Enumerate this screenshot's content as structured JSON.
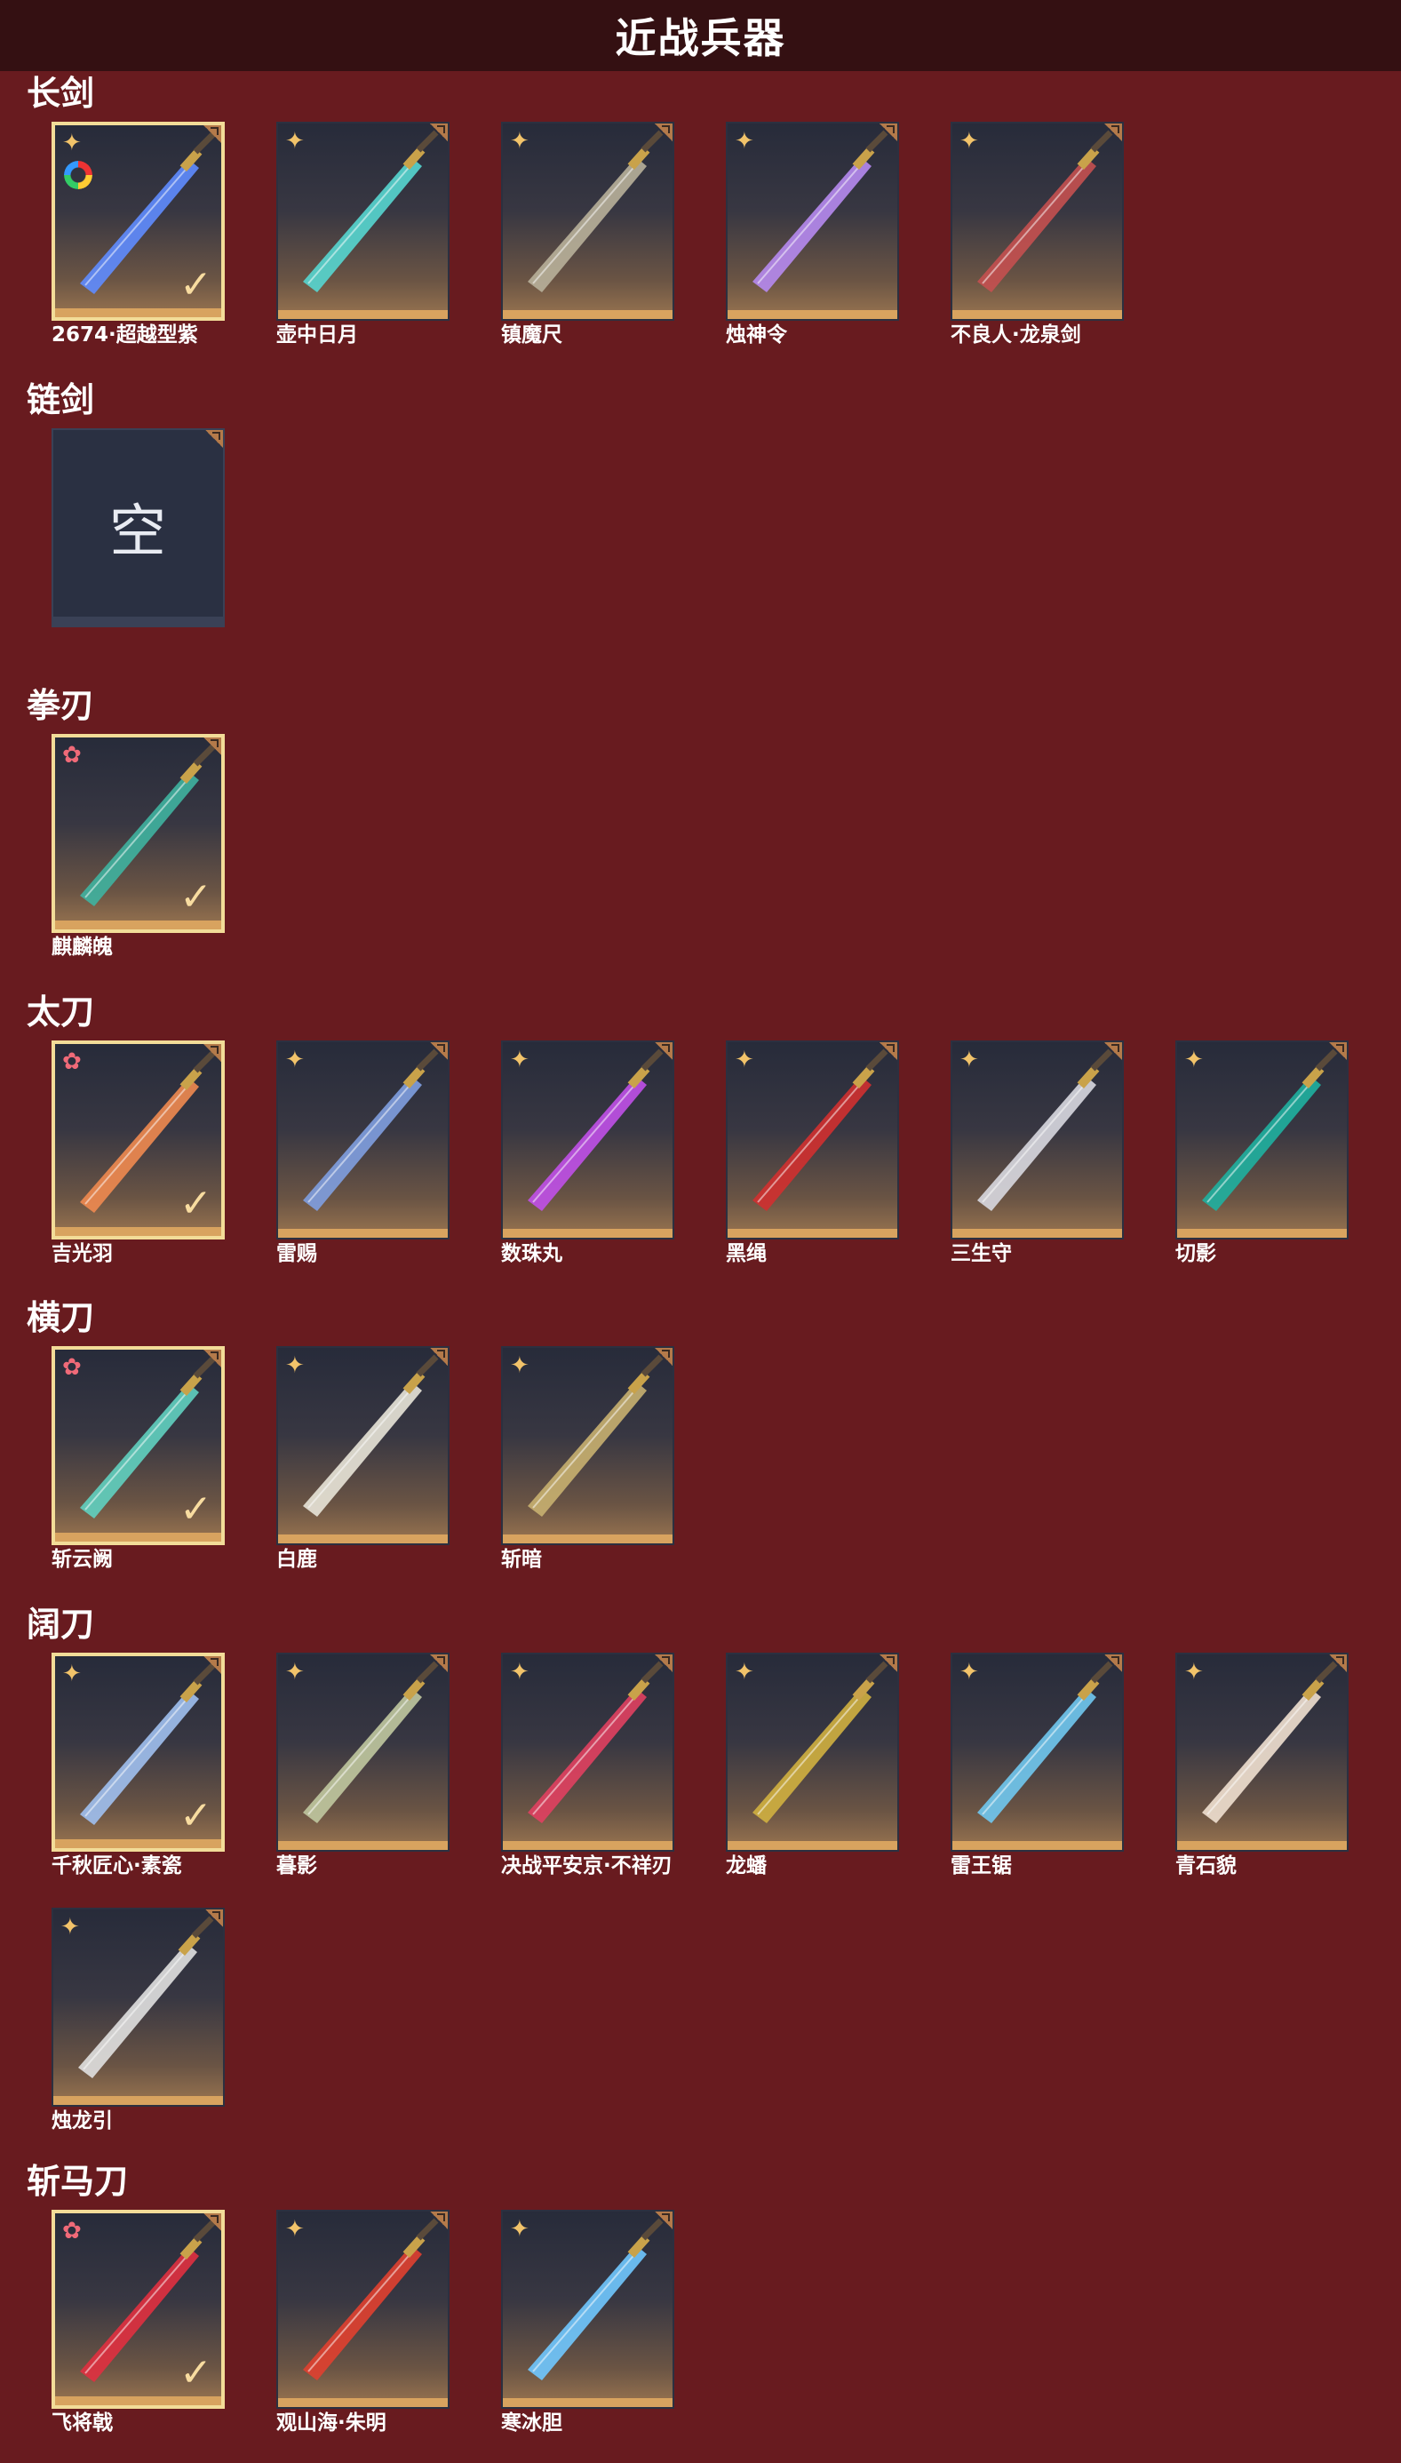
{
  "header": {
    "title": "近战兵器"
  },
  "sections": [
    {
      "title": "长剑",
      "items": [
        {
          "name": "2674·超越型紫",
          "rarity": "gold",
          "selected": true,
          "blade": "#5f8cff",
          "ring": true
        },
        {
          "name": "壶中日月",
          "rarity": "gold",
          "selected": false,
          "blade": "#57d6d0"
        },
        {
          "name": "镇魔尺",
          "rarity": "gold",
          "selected": false,
          "blade": "#b8b09a"
        },
        {
          "name": "烛神令",
          "rarity": "gold",
          "selected": false,
          "blade": "#b68af0"
        },
        {
          "name": "不良人·龙泉剑",
          "rarity": "gold",
          "selected": false,
          "blade": "#c45050"
        }
      ]
    },
    {
      "title": "链剑",
      "items": [
        {
          "name": "",
          "empty": true,
          "empty_text": "空"
        }
      ]
    },
    {
      "title": "拳刃",
      "items": [
        {
          "name": "麒麟魄",
          "rarity": "red",
          "selected": true,
          "blade": "#3fb3a0"
        }
      ]
    },
    {
      "title": "太刀",
      "items": [
        {
          "name": "吉光羽",
          "rarity": "red",
          "selected": true,
          "blade": "#f08a50"
        },
        {
          "name": "雷赐",
          "rarity": "gold",
          "selected": false,
          "blade": "#7f9ee0"
        },
        {
          "name": "数珠丸",
          "rarity": "gold",
          "selected": false,
          "blade": "#c050e8"
        },
        {
          "name": "黑绳",
          "rarity": "gold",
          "selected": false,
          "blade": "#d03030"
        },
        {
          "name": "三生守",
          "rarity": "gold",
          "selected": false,
          "blade": "#d8d8e0"
        },
        {
          "name": "切影",
          "rarity": "gold",
          "selected": false,
          "blade": "#1fb0a0"
        }
      ]
    },
    {
      "title": "横刀",
      "items": [
        {
          "name": "斩云阙",
          "rarity": "red",
          "selected": true,
          "blade": "#60d0c0"
        },
        {
          "name": "白鹿",
          "rarity": "gold",
          "selected": false,
          "blade": "#e8e4d8"
        },
        {
          "name": "斩暗",
          "rarity": "gold",
          "selected": false,
          "blade": "#c8b070"
        }
      ]
    },
    {
      "title": "阔刀",
      "items": [
        {
          "name": "千秋匠心·素瓷",
          "rarity": "gold",
          "selected": true,
          "blade": "#a0c0f0"
        },
        {
          "name": "暮影",
          "rarity": "gold",
          "selected": false,
          "blade": "#c0c8a0"
        },
        {
          "name": "决战平安京·不祥刃",
          "rarity": "gold",
          "selected": false,
          "blade": "#e04060"
        },
        {
          "name": "龙蟠",
          "rarity": "gold",
          "selected": false,
          "blade": "#d0b040"
        },
        {
          "name": "雷王锯",
          "rarity": "gold",
          "selected": false,
          "blade": "#70c8f0"
        },
        {
          "name": "青石貌",
          "rarity": "gold",
          "selected": false,
          "blade": "#f0e0d0"
        },
        {
          "name": "烛龙引",
          "rarity": "gold",
          "selected": false,
          "blade": "#e0e0e0"
        }
      ]
    },
    {
      "title": "斩马刀",
      "items": [
        {
          "name": "飞将戟",
          "rarity": "red",
          "selected": true,
          "blade": "#e03040"
        },
        {
          "name": "观山海·朱明",
          "rarity": "gold",
          "selected": false,
          "blade": "#e04030"
        },
        {
          "name": "寒冰胆",
          "rarity": "gold",
          "selected": false,
          "blade": "#70c8ff"
        }
      ]
    }
  ],
  "icons": {
    "rarity_gold": "gold-star-icon",
    "rarity_red": "red-star-icon",
    "selected": "check-icon",
    "corner": "corner-tab-icon"
  }
}
